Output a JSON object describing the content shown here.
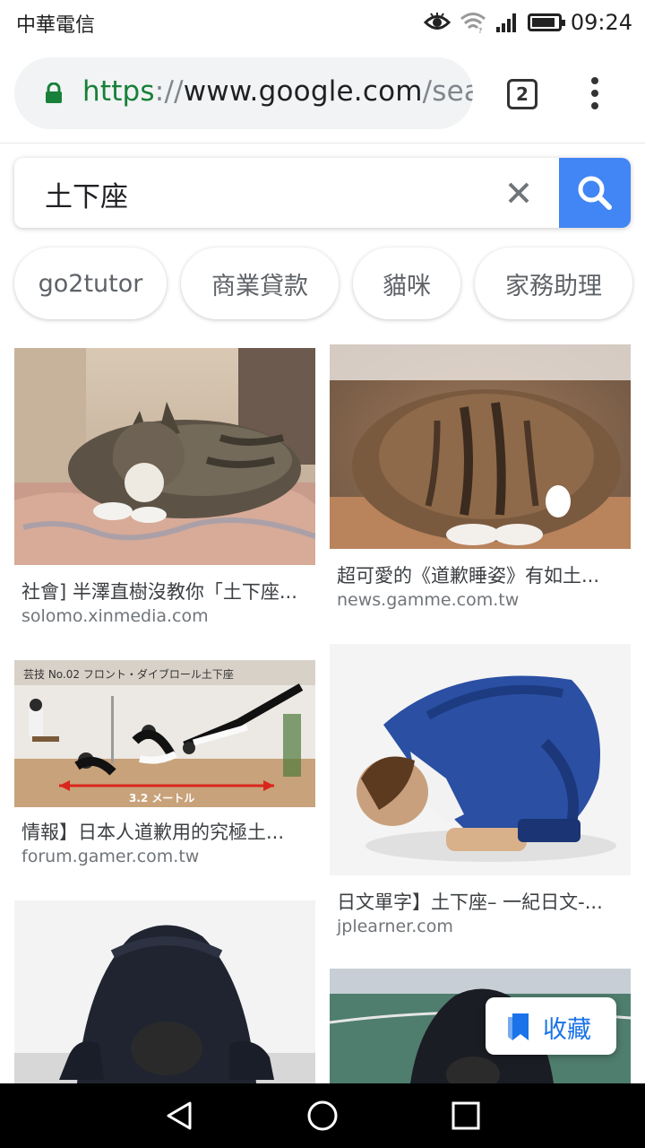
{
  "status_bar": {
    "carrier": "中華電信",
    "time": "09:24",
    "battery_level": 0.9
  },
  "browser": {
    "url": {
      "scheme": "https",
      "separator": "://",
      "host": "www.google.com",
      "path": "/sear"
    },
    "tab_count": "2"
  },
  "search": {
    "query": "土下座"
  },
  "chips": [
    "go2tutor",
    "商業貸款",
    "貓咪",
    "家務助理"
  ],
  "results": [
    {
      "title": "社會] 半澤直樹沒教你「土下座...",
      "source": "solomo.xinmedia.com"
    },
    {
      "title": "超可愛的《道歉睡姿》有如土...",
      "source": "news.gamme.com.tw"
    },
    {
      "title": "情報】日本人道歉用的究極土...",
      "source": "forum.gamer.com.tw",
      "image_caption": "芸技 No.02 フロント・ダイブロール土下座",
      "image_distance": "3.2 メートル"
    },
    {
      "title": "日文單字】土下座– 一紀日文-...",
      "source": "jplearner.com"
    },
    {
      "title": "",
      "source": ""
    },
    {
      "title": "",
      "source": ""
    }
  ],
  "collections": {
    "label": "收藏"
  },
  "colors": {
    "accent": "#4285f4",
    "secure": "#188038",
    "collections": "#1a73e8"
  }
}
